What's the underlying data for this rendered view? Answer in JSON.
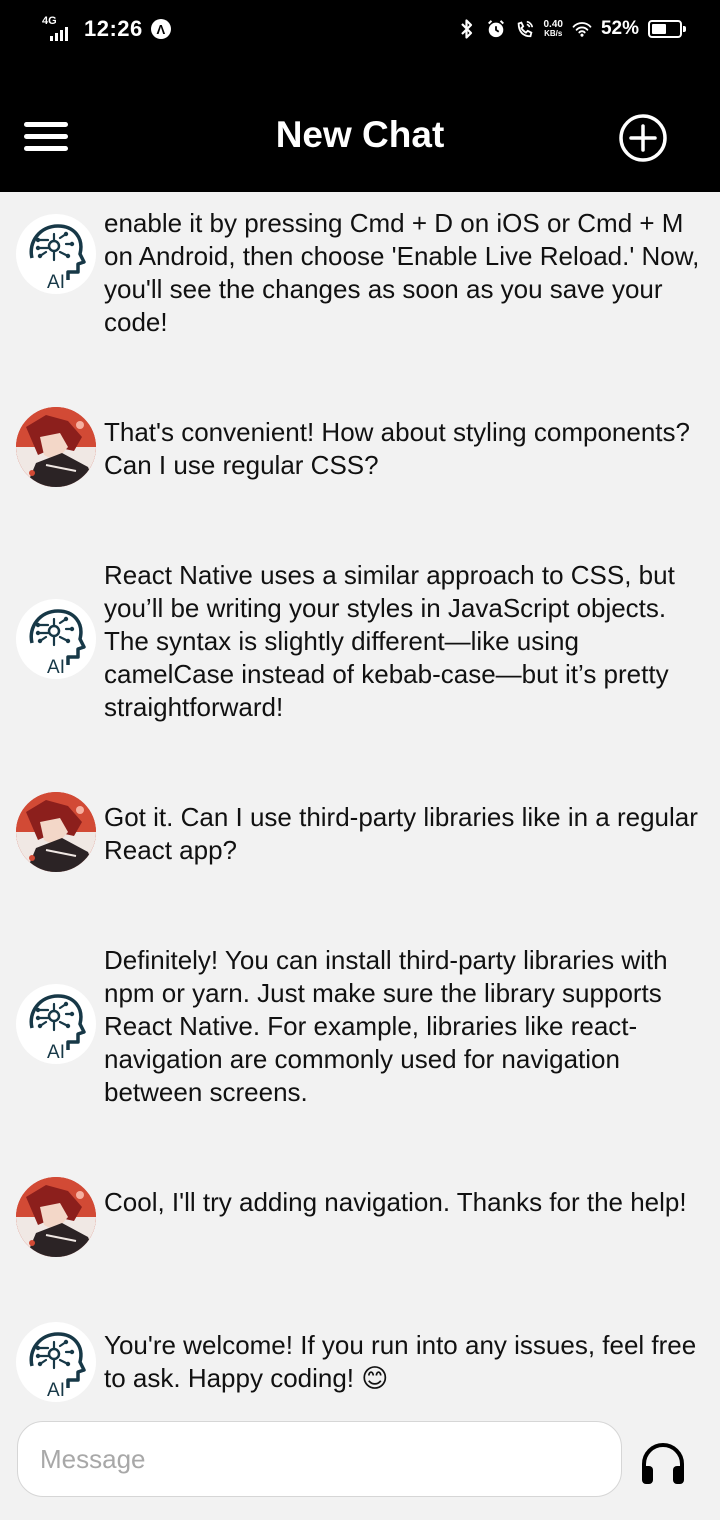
{
  "status_bar": {
    "network": "4G",
    "time": "12:26",
    "speed_value": "0.40",
    "speed_unit": "KB/s",
    "battery_text": "52%",
    "battery_level": 0.52
  },
  "header": {
    "title": "New Chat"
  },
  "icons": {
    "menu": "hamburger-menu-icon",
    "new_chat": "plus-circle-icon",
    "voice": "headphones-icon",
    "ai_avatar": "ai-brain-icon",
    "user_avatar": "anime-character-avatar"
  },
  "messages": [
    {
      "sender": "ai",
      "text": "enable it by pressing Cmd + D on iOS or Cmd + M on Android, then choose 'Enable Live Reload.' Now, you'll see the changes as soon as you save your code!"
    },
    {
      "sender": "user",
      "text": "That's convenient! How about styling components? Can I use regular CSS?"
    },
    {
      "sender": "ai",
      "text": "React Native uses a similar approach to CSS, but you’ll be writing your styles in JavaScript objects. The syntax is slightly different—like using camelCase instead of kebab-case—but it’s pretty straightforward!"
    },
    {
      "sender": "user",
      "text": "Got it. Can I use third-party libraries like in a regular React app?"
    },
    {
      "sender": "ai",
      "text": "Definitely! You can install third-party libraries with npm or yarn. Just make sure the library supports React Native. For example, libraries like react-navigation are commonly used for navigation between screens."
    },
    {
      "sender": "user",
      "text": "Cool, I'll try adding navigation. Thanks for the help!"
    },
    {
      "sender": "ai",
      "text": "You're welcome! If you run into any issues, feel free to ask. Happy coding! 😊"
    }
  ],
  "ai_avatar_label": "AI",
  "input": {
    "placeholder": "Message",
    "value": ""
  }
}
